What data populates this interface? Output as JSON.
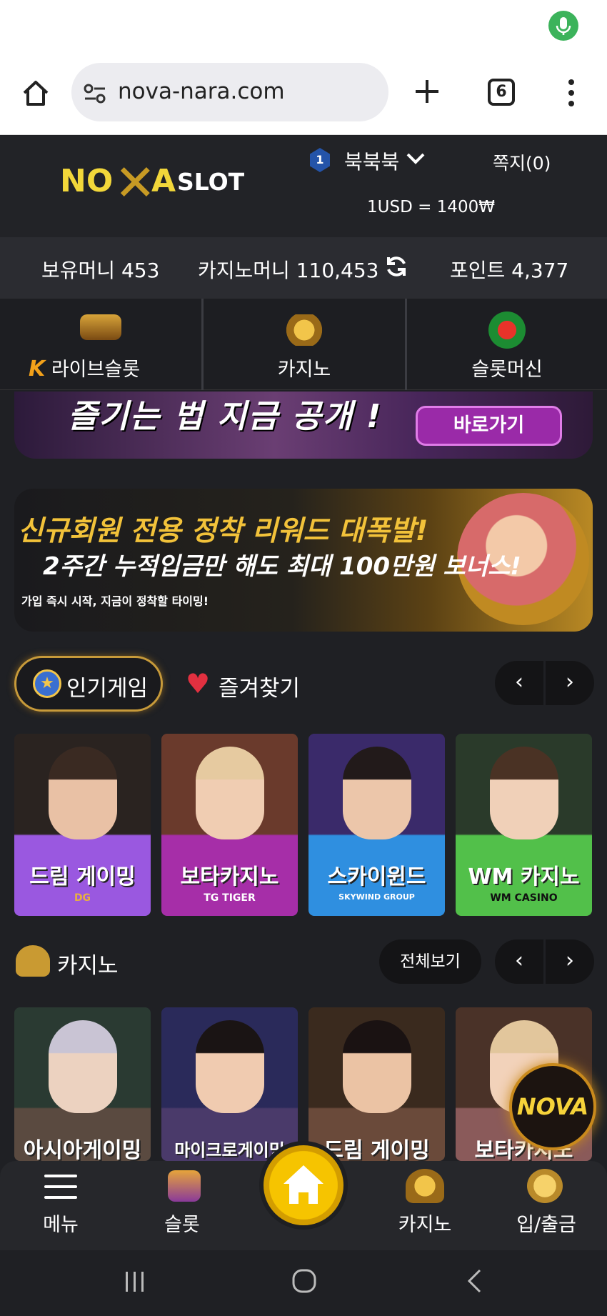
{
  "browser": {
    "url": "nova-nara.com",
    "tab_count": "6"
  },
  "header": {
    "logo_a": "NO",
    "logo_x": "✕",
    "logo_b": "A",
    "logo_slot": "SLOT",
    "level": "1",
    "username": "북북북",
    "messages": "쪽지(0)",
    "exchange": "1USD = 1400₩"
  },
  "balances": {
    "hold": "보유머니 453",
    "casino": "카지노머니 110,453",
    "point": "포인트 4,377"
  },
  "tabs": [
    {
      "label": "라이브슬롯",
      "prefix": "K"
    },
    {
      "label": "카지노"
    },
    {
      "label": "슬롯머신"
    }
  ],
  "banner1": {
    "text": "즐기는 법 지금 공개 !",
    "button": "바로가기"
  },
  "banner2": {
    "line1": "신규회원 전용 정착 리워드 대폭발!",
    "line2": "2주간 누적입금만 해도 최대 100만원 보너스!",
    "line3": "가입 즉시 시작, 지금이 정착할 타이밍!"
  },
  "popular": {
    "tab_active": "인기게임",
    "tab_fav": "즐겨찾기",
    "prev": "‹",
    "next": "›",
    "cards": [
      {
        "name": "드림 게이밍",
        "sub": "DG"
      },
      {
        "name": "보타카지노",
        "sub": "TG TIGER"
      },
      {
        "name": "스카이윈드",
        "sub": "SKYWIND GROUP"
      },
      {
        "name": "WM 카지노",
        "sub": "WM CASINO"
      }
    ]
  },
  "casino": {
    "title": "카지노",
    "all": "전체보기",
    "prev": "‹",
    "next": "›",
    "cards": [
      {
        "name": "아시아게이밍"
      },
      {
        "name": "마이크로게이밍"
      },
      {
        "name": "드림 게이밍"
      },
      {
        "name": "보타카지노"
      }
    ]
  },
  "fab": {
    "label": "NOVA"
  },
  "bottom_nav": {
    "menu": "메뉴",
    "slot": "슬롯",
    "casino": "카지노",
    "deposit": "입/출금"
  }
}
